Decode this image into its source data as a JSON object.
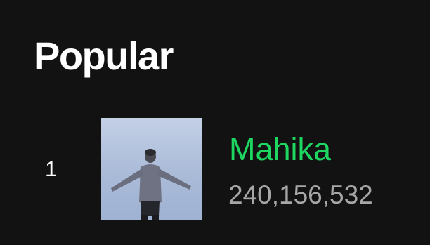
{
  "section": {
    "title": "Popular"
  },
  "tracks": [
    {
      "index": "1",
      "title": "Mahika",
      "plays": "240,156,532",
      "artwork_icon": "album-cover-person-arms-outstretched"
    }
  ],
  "colors": {
    "background": "#121212",
    "title_text": "#ffffff",
    "active_track": "#1ed760",
    "secondary_text": "#a7a7a7"
  }
}
